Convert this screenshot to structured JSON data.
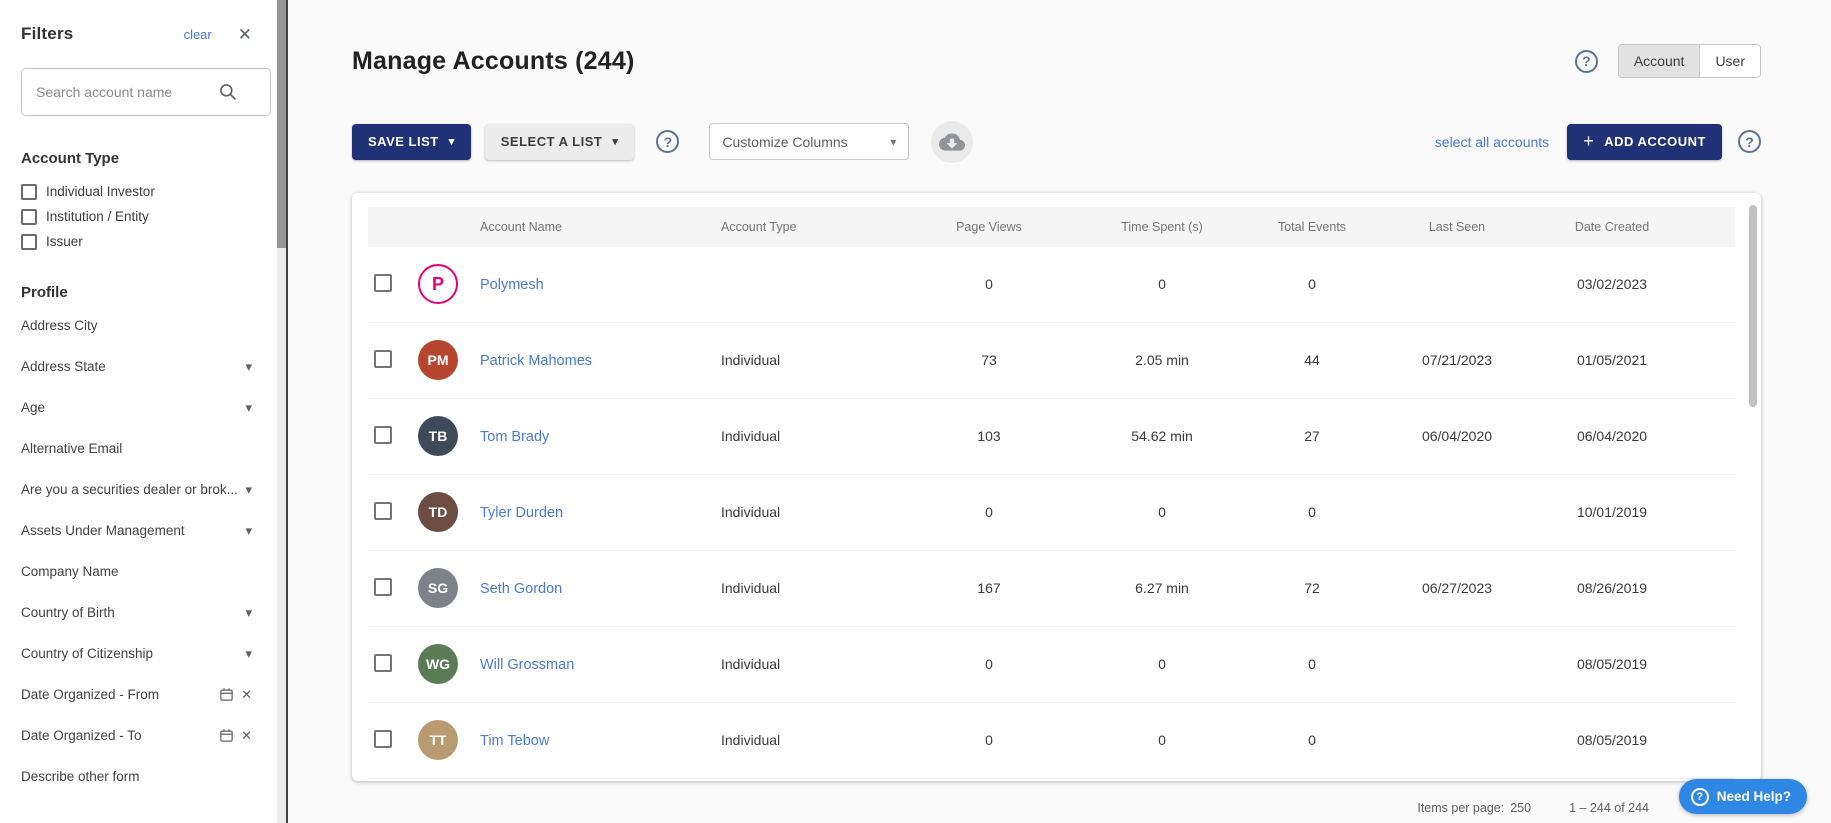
{
  "filters": {
    "title": "Filters",
    "clear_label": "clear",
    "search": {
      "placeholder": "Search account name"
    },
    "account_type": {
      "title": "Account Type",
      "options": [
        "Individual Investor",
        "Institution / Entity",
        "Issuer"
      ]
    },
    "profile": {
      "title": "Profile",
      "items": [
        {
          "label": "Address City",
          "type": "plain"
        },
        {
          "label": "Address State",
          "type": "dropdown"
        },
        {
          "label": "Age",
          "type": "dropdown"
        },
        {
          "label": "Alternative Email",
          "type": "plain"
        },
        {
          "label": "Are you a securities dealer or brok...",
          "type": "dropdown"
        },
        {
          "label": "Assets Under Management",
          "type": "dropdown"
        },
        {
          "label": "Company Name",
          "type": "plain"
        },
        {
          "label": "Country of Birth",
          "type": "dropdown"
        },
        {
          "label": "Country of Citizenship",
          "type": "dropdown"
        },
        {
          "label": "Date Organized - From",
          "type": "date"
        },
        {
          "label": "Date Organized - To",
          "type": "date"
        },
        {
          "label": "Describe other form",
          "type": "plain"
        }
      ]
    }
  },
  "header": {
    "title": "Manage Accounts (244)",
    "toggle": {
      "options": [
        "Account",
        "User"
      ],
      "selected": "Account"
    }
  },
  "toolbar": {
    "save_list": "SAVE LIST",
    "select_a_list": "SELECT A LIST",
    "customize_columns": "Customize Columns",
    "select_all": "select all accounts",
    "add_account": "ADD ACCOUNT"
  },
  "table": {
    "columns": [
      "Account Name",
      "Account Type",
      "Page Views",
      "Time Spent (s)",
      "Total Events",
      "Last Seen",
      "Date Created"
    ],
    "rows": [
      {
        "name": "Polymesh",
        "type": "",
        "page_views": "0",
        "time_spent": "0",
        "total_events": "0",
        "last_seen": "",
        "date_created": "03/02/2023",
        "avatar": {
          "kind": "logo",
          "letter": "P",
          "color": "#e6007a"
        }
      },
      {
        "name": "Patrick Mahomes",
        "type": "Individual",
        "page_views": "73",
        "time_spent": "2.05 min",
        "total_events": "44",
        "last_seen": "07/21/2023",
        "date_created": "01/05/2021",
        "avatar": {
          "kind": "photo",
          "initials": "PM",
          "color": "#b5452f"
        }
      },
      {
        "name": "Tom Brady",
        "type": "Individual",
        "page_views": "103",
        "time_spent": "54.62 min",
        "total_events": "27",
        "last_seen": "06/04/2020",
        "date_created": "06/04/2020",
        "avatar": {
          "kind": "photo",
          "initials": "TB",
          "color": "#3e4a5a"
        }
      },
      {
        "name": "Tyler Durden",
        "type": "Individual",
        "page_views": "0",
        "time_spent": "0",
        "total_events": "0",
        "last_seen": "",
        "date_created": "10/01/2019",
        "avatar": {
          "kind": "photo",
          "initials": "TD",
          "color": "#6d4c41"
        }
      },
      {
        "name": "Seth Gordon",
        "type": "Individual",
        "page_views": "167",
        "time_spent": "6.27 min",
        "total_events": "72",
        "last_seen": "06/27/2023",
        "date_created": "08/26/2019",
        "avatar": {
          "kind": "photo",
          "initials": "SG",
          "color": "#7d8289"
        }
      },
      {
        "name": "Will Grossman",
        "type": "Individual",
        "page_views": "0",
        "time_spent": "0",
        "total_events": "0",
        "last_seen": "",
        "date_created": "08/05/2019",
        "avatar": {
          "kind": "photo",
          "initials": "WG",
          "color": "#5b7b57"
        }
      },
      {
        "name": "Tim Tebow",
        "type": "Individual",
        "page_views": "0",
        "time_spent": "0",
        "total_events": "0",
        "last_seen": "",
        "date_created": "08/05/2019",
        "avatar": {
          "kind": "photo",
          "initials": "TT",
          "color": "#b99b72"
        }
      }
    ]
  },
  "footer": {
    "items_per_page_label": "Items per page:",
    "items_per_page_value": "250",
    "range": "1 – 244 of 244"
  },
  "help_button": {
    "label": "Need Help?",
    "icon": "?"
  },
  "icons": {
    "caret_down": "▾",
    "close": "✕",
    "plus": "+",
    "question": "?"
  },
  "colors": {
    "navy_button": "#203176",
    "link_blue": "#4a7bd4",
    "help_blue": "#2f87e4",
    "polymesh_magenta": "#e6007a"
  }
}
